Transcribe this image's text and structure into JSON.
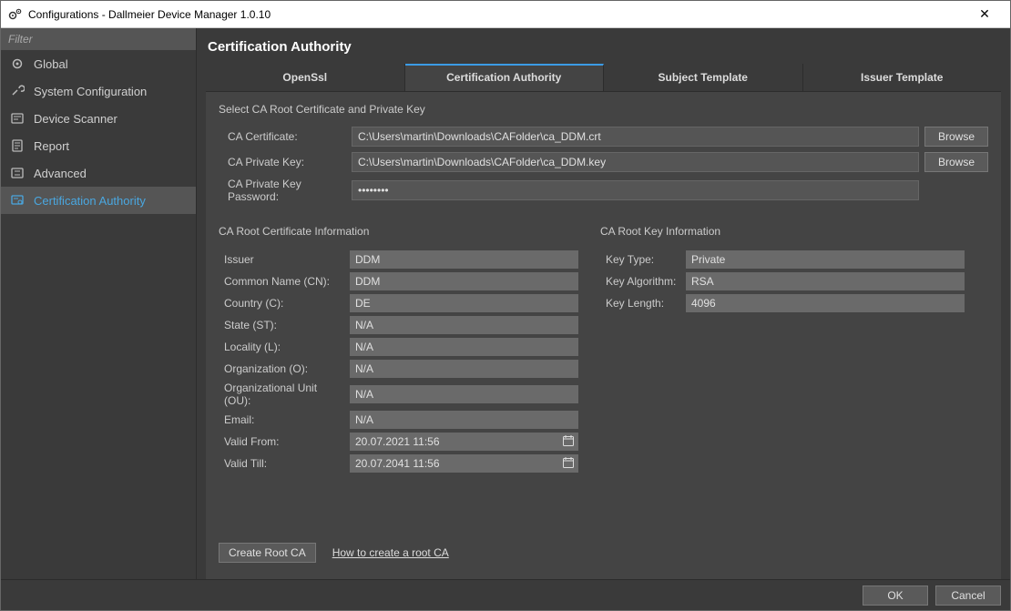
{
  "window": {
    "title": "Configurations - Dallmeier Device Manager 1.0.10"
  },
  "sidebar": {
    "filter_placeholder": "Filter",
    "items": [
      {
        "label": "Global",
        "icon": "gear-icon"
      },
      {
        "label": "System Configuration",
        "icon": "wrench-gear-icon"
      },
      {
        "label": "Device Scanner",
        "icon": "scanner-icon"
      },
      {
        "label": "Report",
        "icon": "report-icon"
      },
      {
        "label": "Advanced",
        "icon": "advanced-icon"
      },
      {
        "label": "Certification Authority",
        "icon": "certificate-icon"
      }
    ],
    "active_index": 5
  },
  "page": {
    "title": "Certification Authority",
    "tabs": [
      {
        "label": "OpenSsl"
      },
      {
        "label": "Certification Authority"
      },
      {
        "label": "Subject Template"
      },
      {
        "label": "Issuer Template"
      }
    ],
    "active_tab": 1
  },
  "ca_select": {
    "heading": "Select CA Root Certificate and Private Key",
    "cert_label": "CA Certificate:",
    "cert_value": "C:\\Users\\martin\\Downloads\\CAFolder\\ca_DDM.crt",
    "key_label": "CA Private Key:",
    "key_value": "C:\\Users\\martin\\Downloads\\CAFolder\\ca_DDM.key",
    "pw_label": "CA Private Key Password:",
    "pw_value": "••••••••",
    "browse_label": "Browse"
  },
  "cert_info": {
    "heading": "CA Root Certificate Information",
    "rows": [
      {
        "label": "Issuer",
        "value": "DDM"
      },
      {
        "label": "Common Name (CN):",
        "value": "DDM"
      },
      {
        "label": "Country (C):",
        "value": "DE"
      },
      {
        "label": "State (ST):",
        "value": "N/A"
      },
      {
        "label": "Locality (L):",
        "value": "N/A"
      },
      {
        "label": "Organization (O):",
        "value": "N/A"
      },
      {
        "label": "Organizational Unit (OU):",
        "value": "N/A"
      },
      {
        "label": "Email:",
        "value": "N/A"
      },
      {
        "label": "Valid From:",
        "value": "20.07.2021 11:56",
        "calendar": true
      },
      {
        "label": "Valid Till:",
        "value": "20.07.2041 11:56",
        "calendar": true
      }
    ]
  },
  "key_info": {
    "heading": "CA Root Key Information",
    "rows": [
      {
        "label": "Key Type:",
        "value": "Private"
      },
      {
        "label": "Key Algorithm:",
        "value": "RSA"
      },
      {
        "label": "Key Length:",
        "value": "4096"
      }
    ]
  },
  "actions": {
    "create_root_ca": "Create Root CA",
    "howto_link": "How to create a root CA"
  },
  "footer": {
    "ok": "OK",
    "cancel": "Cancel"
  }
}
